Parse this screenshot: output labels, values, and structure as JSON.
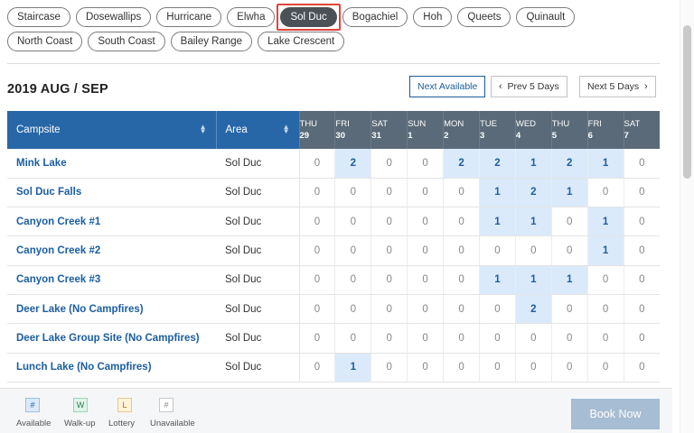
{
  "filters": {
    "row1": [
      "Staircase",
      "Dosewallips",
      "Hurricane",
      "Elwha",
      "Sol Duc",
      "Bogachiel",
      "Hoh",
      "Queets",
      "Quinault"
    ],
    "row2": [
      "North Coast",
      "South Coast",
      "Bailey Range",
      "Lake Crescent"
    ],
    "active": "Sol Duc"
  },
  "header": {
    "date_title": "2019 AUG / SEP",
    "next_available": "Next Available",
    "prev_days": "Prev 5 Days",
    "next_days": "Next 5 Days"
  },
  "table": {
    "col_campsite": "Campsite",
    "col_area": "Area",
    "days": [
      {
        "dow": "THU",
        "dom": "29"
      },
      {
        "dow": "FRI",
        "dom": "30"
      },
      {
        "dow": "SAT",
        "dom": "31"
      },
      {
        "dow": "SUN",
        "dom": "1"
      },
      {
        "dow": "MON",
        "dom": "2"
      },
      {
        "dow": "TUE",
        "dom": "3"
      },
      {
        "dow": "WED",
        "dom": "4"
      },
      {
        "dow": "THU",
        "dom": "5"
      },
      {
        "dow": "FRI",
        "dom": "6"
      },
      {
        "dow": "SAT",
        "dom": "7"
      }
    ],
    "rows": [
      {
        "name": "Mink Lake",
        "area": "Sol Duc",
        "values": [
          0,
          2,
          0,
          0,
          2,
          2,
          1,
          2,
          1,
          0
        ]
      },
      {
        "name": "Sol Duc Falls",
        "area": "Sol Duc",
        "values": [
          0,
          0,
          0,
          0,
          0,
          1,
          2,
          1,
          0,
          0
        ]
      },
      {
        "name": "Canyon Creek #1",
        "area": "Sol Duc",
        "values": [
          0,
          0,
          0,
          0,
          0,
          1,
          1,
          0,
          1,
          0
        ]
      },
      {
        "name": "Canyon Creek #2",
        "area": "Sol Duc",
        "values": [
          0,
          0,
          0,
          0,
          0,
          0,
          0,
          0,
          1,
          0
        ]
      },
      {
        "name": "Canyon Creek #3",
        "area": "Sol Duc",
        "values": [
          0,
          0,
          0,
          0,
          0,
          1,
          1,
          1,
          0,
          0
        ]
      },
      {
        "name": "Deer Lake (No Campfires)",
        "area": "Sol Duc",
        "values": [
          0,
          0,
          0,
          0,
          0,
          0,
          2,
          0,
          0,
          0
        ]
      },
      {
        "name": "Deer Lake Group Site (No Campfires)",
        "area": "Sol Duc",
        "values": [
          0,
          0,
          0,
          0,
          0,
          0,
          0,
          0,
          0,
          0
        ]
      },
      {
        "name": "Lunch Lake (No Campfires)",
        "area": "Sol Duc",
        "values": [
          0,
          1,
          0,
          0,
          0,
          0,
          0,
          0,
          0,
          0
        ]
      }
    ]
  },
  "legend": [
    {
      "symbol": "#",
      "label": "Available",
      "bg": "#dbeafa",
      "border": "#9dbfe3",
      "color": "#1b5ea1"
    },
    {
      "symbol": "W",
      "label": "Walk-up",
      "bg": "#dff3ea",
      "border": "#9fd3b8",
      "color": "#2b7a50"
    },
    {
      "symbol": "L",
      "label": "Lottery",
      "bg": "#fff3d9",
      "border": "#e8c98a",
      "color": "#a86f10"
    },
    {
      "symbol": "#",
      "label": "Unavailable",
      "bg": "#ffffff",
      "border": "#c8c8c8",
      "color": "#888888"
    }
  ],
  "book_now": "Book Now",
  "colors": {
    "accent": "#2767a8",
    "day_header": "#5a6a78",
    "available_cell": "#dbeafa",
    "link": "#1b5ea1"
  }
}
